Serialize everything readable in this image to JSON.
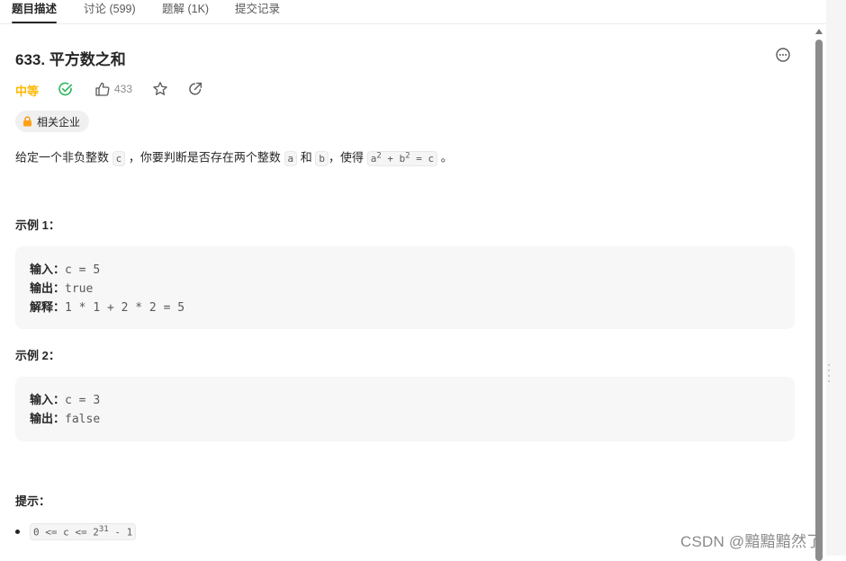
{
  "tabs": [
    {
      "label": "题目描述",
      "active": true
    },
    {
      "label": "讨论 (599)",
      "active": false
    },
    {
      "label": "题解 (1K)",
      "active": false
    },
    {
      "label": "提交记录",
      "active": false
    }
  ],
  "problem": {
    "title": "633. 平方数之和",
    "difficulty": "中等",
    "likes": "433",
    "company_tag": "相关企业"
  },
  "description": {
    "p1": "给定一个非负整数",
    "c": "c",
    "p2": "，你要判断是否存在两个整数",
    "a": "a",
    "p3": "和",
    "b": "b",
    "p4": "，使得",
    "eq_a": "a",
    "eq_exp1": "2",
    "eq_plus": " + b",
    "eq_exp2": "2",
    "eq_rest": " = c",
    "p5": "。"
  },
  "examples": [
    {
      "heading": "示例 1：",
      "lines": [
        {
          "k": "输入：",
          "v": "c = 5"
        },
        {
          "k": "输出：",
          "v": "true"
        },
        {
          "k": "解释：",
          "v": "1 * 1 + 2 * 2 = 5"
        }
      ]
    },
    {
      "heading": "示例 2：",
      "lines": [
        {
          "k": "输入：",
          "v": "c = 3"
        },
        {
          "k": "输出：",
          "v": "false"
        }
      ]
    }
  ],
  "hints": {
    "heading": "提示：",
    "constraint_pre": "0 <= c <= 2",
    "constraint_exp": "31",
    "constraint_post": " - 1"
  },
  "watermark": "CSDN @黯黯黯然了",
  "colors": {
    "difficulty_medium": "#ffb800",
    "accepted_green": "#2db55d",
    "text_primary": "#262626",
    "text_secondary": "#8c8c8c"
  }
}
